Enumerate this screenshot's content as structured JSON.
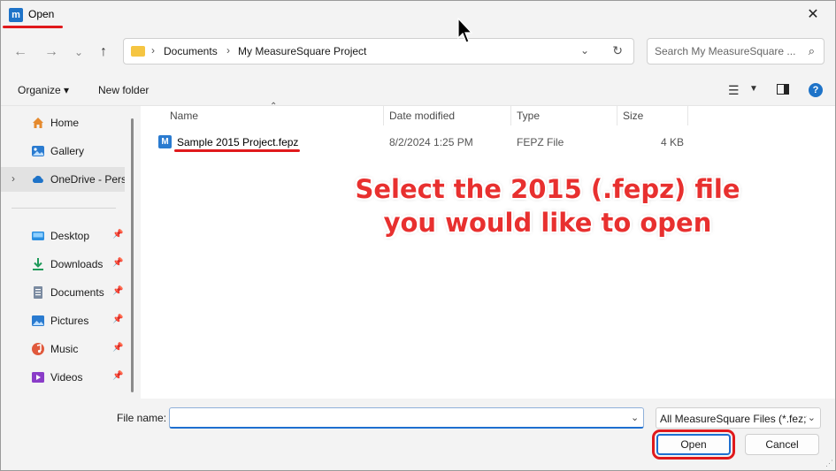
{
  "window": {
    "title": "Open",
    "app_icon_glyph": "m",
    "close_glyph": "✕"
  },
  "nav": {
    "back_glyph": "←",
    "forward_glyph": "→",
    "recent_glyph": "⌄",
    "up_glyph": "↑",
    "breadcrumb": [
      "Documents",
      "My MeasureSquare Project"
    ],
    "search_placeholder": "Search My MeasureSquare ..."
  },
  "toolbar": {
    "organize_label": "Organize ▾",
    "new_folder_label": "New folder"
  },
  "sidebar": {
    "top_items": [
      {
        "label": "Home",
        "icon": "home-icon",
        "color": "#e58a2e"
      },
      {
        "label": "Gallery",
        "icon": "gallery-icon",
        "color": "#2a7bd0"
      },
      {
        "label": "OneDrive - Personal",
        "icon": "cloud-icon",
        "color": "#1e73c8"
      }
    ],
    "quick_access": [
      {
        "label": "Desktop",
        "icon": "desktop-icon",
        "color": "#2b8fe0"
      },
      {
        "label": "Downloads",
        "icon": "download-icon",
        "color": "#1f9a5a"
      },
      {
        "label": "Documents",
        "icon": "documents-icon",
        "color": "#7a8aa0"
      },
      {
        "label": "Pictures",
        "icon": "pictures-icon",
        "color": "#2a7bd0"
      },
      {
        "label": "Music",
        "icon": "music-icon",
        "color": "#e0593c"
      },
      {
        "label": "Videos",
        "icon": "videos-icon",
        "color": "#8a3cc8"
      }
    ]
  },
  "columns": {
    "name": "Name",
    "date": "Date modified",
    "type": "Type",
    "size": "Size"
  },
  "files": [
    {
      "name": "Sample 2015 Project.fepz",
      "date": "8/2/2024 1:25 PM",
      "type": "FEPZ File",
      "size": "4 KB",
      "icon_glyph": "M"
    }
  ],
  "callout": {
    "line1": "Select the 2015 (.fepz) file",
    "line2": "you would like to open"
  },
  "bottom": {
    "file_name_label": "File name:",
    "file_name_value": "",
    "filter_value": "All MeasureSquare Files (*.fez;*.",
    "open_label": "Open",
    "cancel_label": "Cancel"
  },
  "colors": {
    "accent": "#1e6fd0",
    "annotation_red": "#e0191c"
  }
}
